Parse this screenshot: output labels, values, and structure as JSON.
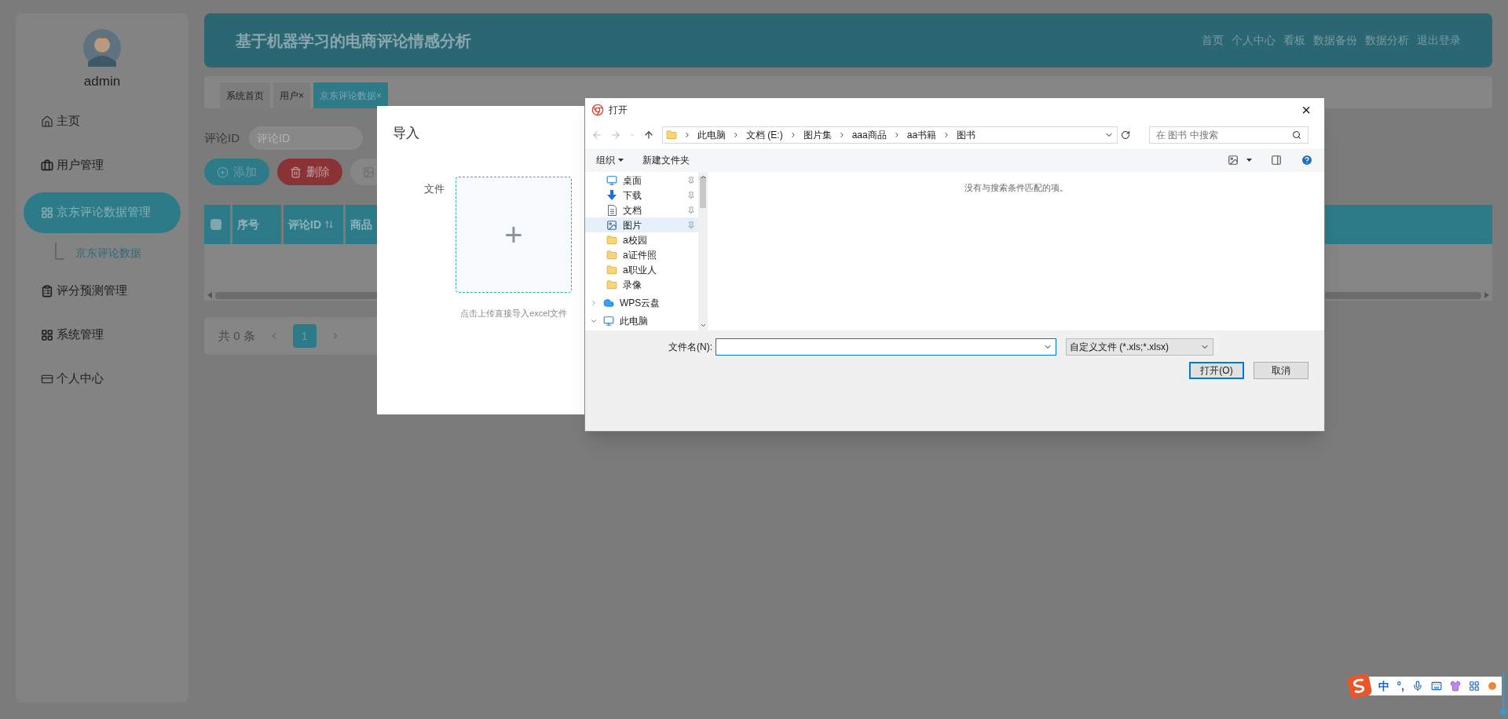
{
  "sidebar": {
    "user": "admin",
    "menu": [
      {
        "label": "主页",
        "selected": false
      },
      {
        "label": "用户管理",
        "selected": false
      },
      {
        "label": "京东评论数据管理",
        "selected": true,
        "children": [
          {
            "label": "京东评论数据",
            "selected": false
          }
        ]
      },
      {
        "label": "评分预测管理",
        "selected": false
      },
      {
        "label": "系统管理",
        "selected": false
      },
      {
        "label": "个人中心",
        "selected": false
      }
    ]
  },
  "header": {
    "title": "基于机器学习的电商评论情感分析",
    "links": [
      "首页",
      "个人中心",
      "看板",
      "数据备份",
      "数据分析",
      "退出登录"
    ]
  },
  "tabs": [
    {
      "label": "系统首页",
      "selected": false
    },
    {
      "label": "用户",
      "close_mark": "×",
      "selected": false
    },
    {
      "label": "京东评论数据",
      "close_mark": "×",
      "selected": true
    }
  ],
  "search": {
    "label": "评论ID",
    "placeholder": "评论ID"
  },
  "actions": [
    {
      "kind": "add",
      "label": "添加"
    },
    {
      "kind": "delete",
      "label": "删除"
    },
    {
      "kind": "import"
    }
  ],
  "table": {
    "header_checked": false,
    "columns": [
      {
        "label": "序号",
        "sortable": false
      },
      {
        "label": "评论ID",
        "sortable": true
      },
      {
        "label": "商品"
      }
    ]
  },
  "pagination": {
    "total": "共 0 条",
    "pages": [
      {
        "label": "1",
        "selected": true
      }
    ]
  },
  "import_dialog": {
    "title": "导入",
    "field_label": "文件",
    "plus": "+",
    "hint": "点击上传直接导入excel文件"
  },
  "file_dialog": {
    "title": "打开",
    "close": "×",
    "path": [
      "此电脑",
      "文档 (E:)",
      "图片集",
      "aaa商品",
      "aa书籍",
      "图书"
    ],
    "search_placeholder": "在 图书 中搜索",
    "toolbar": [
      "组织",
      "新建文件夹"
    ],
    "nav": [
      {
        "label": "桌面",
        "kind": "quick",
        "pinned": true,
        "selected": false
      },
      {
        "label": "下载",
        "kind": "quick",
        "pinned": true,
        "selected": false
      },
      {
        "label": "文档",
        "kind": "quick",
        "pinned": true,
        "selected": false
      },
      {
        "label": "图片",
        "kind": "quick",
        "pinned": true,
        "selected": true
      },
      {
        "label": "a校园",
        "kind": "quick",
        "pinned": false,
        "selected": false
      },
      {
        "label": "a证件照",
        "kind": "quick",
        "pinned": false,
        "selected": false
      },
      {
        "label": "a职业人",
        "kind": "quick",
        "pinned": false,
        "selected": false
      },
      {
        "label": "录像",
        "kind": "quick",
        "pinned": false,
        "selected": false
      },
      {
        "label": "WPS云盘",
        "kind": "root",
        "selected": false,
        "expanded": false
      },
      {
        "label": "此电脑",
        "kind": "root",
        "selected": false,
        "expanded": true
      }
    ],
    "empty_message": "没有与搜索条件匹配的项。",
    "filename_label": "文件名(N):",
    "filetype": "自定义文件 (*.xls;*.xlsx)",
    "buttons": [
      "打开(O)",
      "取消"
    ]
  },
  "ime": {
    "mode": "中",
    "punctuation": "°,"
  }
}
